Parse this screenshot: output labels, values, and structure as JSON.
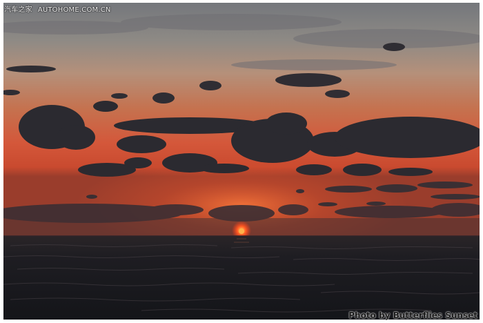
{
  "watermark": {
    "site_name": "汽车之家",
    "site_url": "AUTOHOME.COM.CN"
  },
  "photo_credit": "Photo by Butterflies Sunset",
  "colors": {
    "sky_top": "#7d7f83",
    "sky_mid": "#c98a63",
    "horizon_glow": "#e2502a",
    "sea": "#1b1d23",
    "cloud": "#2c2b31",
    "sun": "#ff3a1a"
  }
}
